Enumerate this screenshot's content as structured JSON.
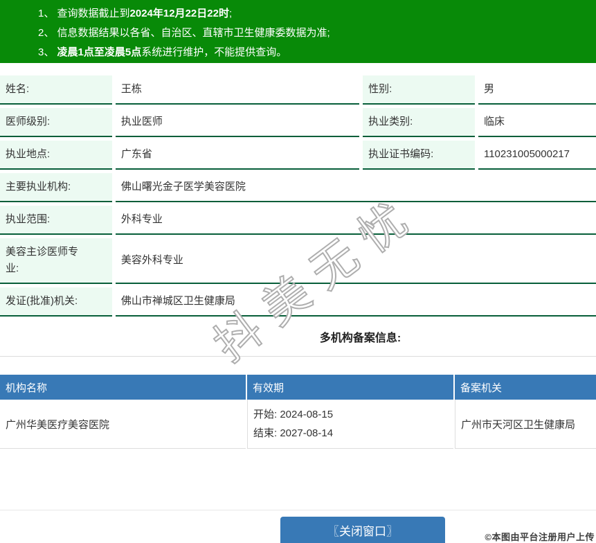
{
  "banner": {
    "bg_color": "#088a08",
    "notices": [
      {
        "num": "1、",
        "pre": "查询数据截止到",
        "bold": "2024年12月22日22时",
        "post": ";"
      },
      {
        "num": "2、",
        "pre": "信息数据结果以各省、自治区、直辖市卫生健康委数据为准;",
        "bold": "",
        "post": ""
      },
      {
        "num": "3、",
        "pre": "",
        "bold": "凌晨1点至凌晨5点",
        "post": "系统进行维护，不能提供查询。"
      }
    ]
  },
  "info_table": {
    "label_bg": "#ecfaf2",
    "border_color": "#075e39",
    "rows4col": [
      {
        "label1": "姓名:",
        "value1": "王栋",
        "label2": "性别:",
        "value2": "男"
      },
      {
        "label1": "医师级别:",
        "value1": "执业医师",
        "label2": "执业类别:",
        "value2": "临床"
      },
      {
        "label1": "执业地点:",
        "value1": "广东省",
        "label2": "执业证书编码:",
        "value2": "110231005000217"
      }
    ],
    "rows2col": [
      {
        "label": "主要执业机构:",
        "value": "佛山曙光金子医学美容医院"
      },
      {
        "label": "执业范围:",
        "value": "外科专业"
      },
      {
        "label": "美容主诊医师专业:",
        "value": "美容外科专业"
      },
      {
        "label": "发证(批准)机关:",
        "value": "佛山市禅城区卫生健康局"
      }
    ]
  },
  "filing_section": {
    "title": "多机构备案信息:",
    "header_bg": "#3879b6",
    "headers": [
      "机构名称",
      "有效期",
      "备案机关"
    ],
    "rows": [
      {
        "name": "广州华美医疗美容医院",
        "valid_start": "开始: 2024-08-15",
        "valid_end": "结束: 2027-08-14",
        "authority": "广州市天河区卫生健康局"
      }
    ]
  },
  "watermark": {
    "text": "抖美无忧"
  },
  "footer": {
    "close_button_label": "〖关闭窗口〗",
    "button_color": "#3879b6"
  },
  "copyright": "©本图由平台注册用户上传"
}
